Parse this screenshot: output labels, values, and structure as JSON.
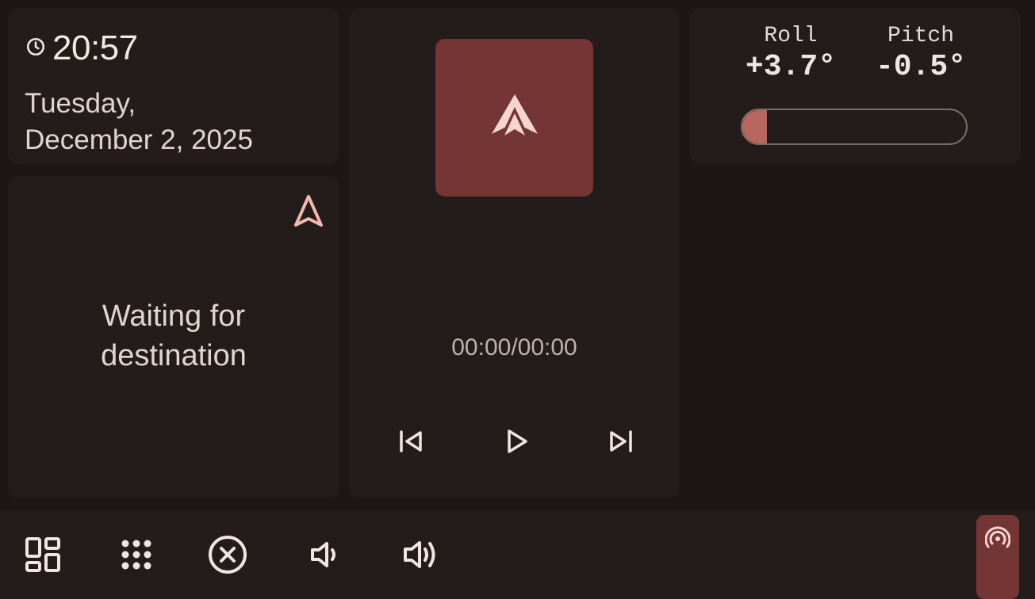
{
  "clock": {
    "time": "20:57",
    "date": "Tuesday,\nDecember 2, 2025"
  },
  "navigation": {
    "status": "Waiting for\ndestination"
  },
  "media": {
    "progress": "00:00/00:00"
  },
  "tilt": {
    "roll_label": "Roll",
    "roll_value": "+3.7°",
    "pitch_label": "Pitch",
    "pitch_value": "-0.5°",
    "bar_level": 0.11
  },
  "colors": {
    "accent": "#733635",
    "accent_light": "#f4b8b0",
    "background": "#1c1615",
    "card": "#231c1b"
  },
  "icons": {
    "clock": "clock-icon",
    "nav": "navigation-arrow-icon",
    "album": "android-auto-icon",
    "prev": "skip-previous-icon",
    "play": "play-icon",
    "next": "skip-next-icon",
    "dashboard": "dashboard-icon",
    "apps": "app-grid-icon",
    "close": "close-circle-icon",
    "vol_down": "volume-down-icon",
    "vol_up": "volume-up-icon",
    "assistant": "assistant-broadcast-icon"
  }
}
